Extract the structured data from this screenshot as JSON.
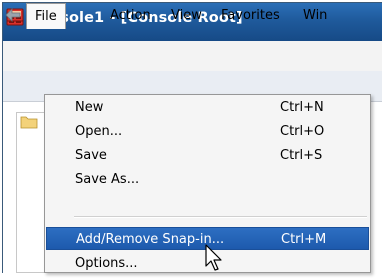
{
  "window": {
    "title": "Console1 - [Console Root]"
  },
  "menubar": {
    "items": [
      {
        "label": "File"
      },
      {
        "label": "Action"
      },
      {
        "label": "View"
      },
      {
        "label": "Favorites"
      },
      {
        "label": "Win"
      }
    ]
  },
  "file_menu": {
    "items": [
      {
        "label": "New",
        "shortcut": "Ctrl+N"
      },
      {
        "label": "Open...",
        "shortcut": "Ctrl+O"
      },
      {
        "label": "Save",
        "shortcut": "Ctrl+S"
      },
      {
        "label": "Save As...",
        "shortcut": ""
      },
      {
        "label": "Add/Remove Snap-in...",
        "shortcut": "Ctrl+M",
        "highlighted": true
      },
      {
        "label": "Options...",
        "shortcut": ""
      }
    ]
  },
  "icons": {
    "app": "mmc-console-icon",
    "back": "back-arrow-icon",
    "folder": "folder-icon",
    "cursor": "mouse-pointer-icon"
  },
  "colors": {
    "titlebar": "#1f5a9c",
    "highlight": "#1d5aad",
    "menu_background": "#f5f5f5"
  }
}
